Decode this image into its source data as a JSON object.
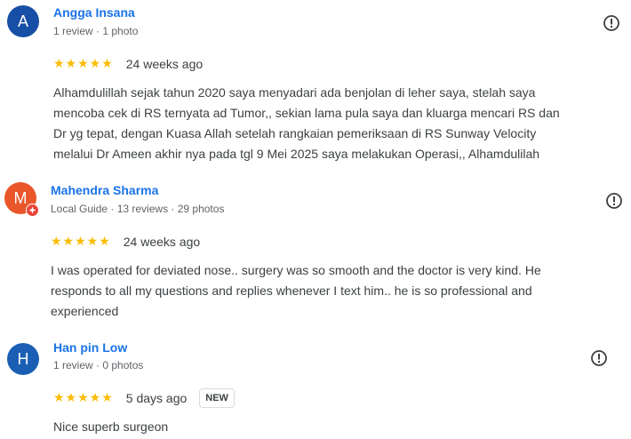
{
  "colors": {
    "link": "#1a73e8",
    "star": "#fbbc04",
    "avatar_A": "#174ea6",
    "avatar_M": "#e8562a",
    "avatar_H": "#1a5fb4"
  },
  "reviews": [
    {
      "avatar_letter": "A",
      "name": "Angga Insana",
      "meta": "1 review · 1 photo",
      "stars": "★★★★★",
      "rating": 5,
      "date": "24 weeks ago",
      "more_icon": "report-icon",
      "text_lines": [
        "Alhamdulillah sejak tahun 2020 saya menyadari ada benjolan di leher saya, stelah saya",
        "mencoba cek di RS ternyata ad Tumor,, sekian lama pula saya dan kluarga mencari RS dan",
        "Dr yg tepat, dengan Kuasa Allah setelah rangkaian pemeriksaan di RS Sunway Velocity",
        "melalui Dr Ameen akhir nya pada tgl 9 Mei 2025 saya melakukan Operasi,, Alhamdulilah"
      ]
    },
    {
      "avatar_letter": "M",
      "local_guide": true,
      "name": "Mahendra Sharma",
      "meta": "Local Guide · 13 reviews · 29 photos",
      "stars": "★★★★★",
      "rating": 5,
      "date": "24 weeks ago",
      "more_icon": "report-icon",
      "text_lines": [
        "I was operated for deviated nose.. surgery was so smooth and the doctor is very kind. He",
        "responds to all my questions and replies whenever I text him.. he is so professional and",
        "experienced"
      ]
    },
    {
      "avatar_letter": "H",
      "name": "Han pin Low",
      "meta": "1 review · 0 photos",
      "stars": "★★★★★",
      "rating": 5,
      "date": "5 days ago",
      "badge": "NEW",
      "more_icon": "report-icon",
      "text_lines": [
        "Nice superb surgeon"
      ]
    }
  ]
}
